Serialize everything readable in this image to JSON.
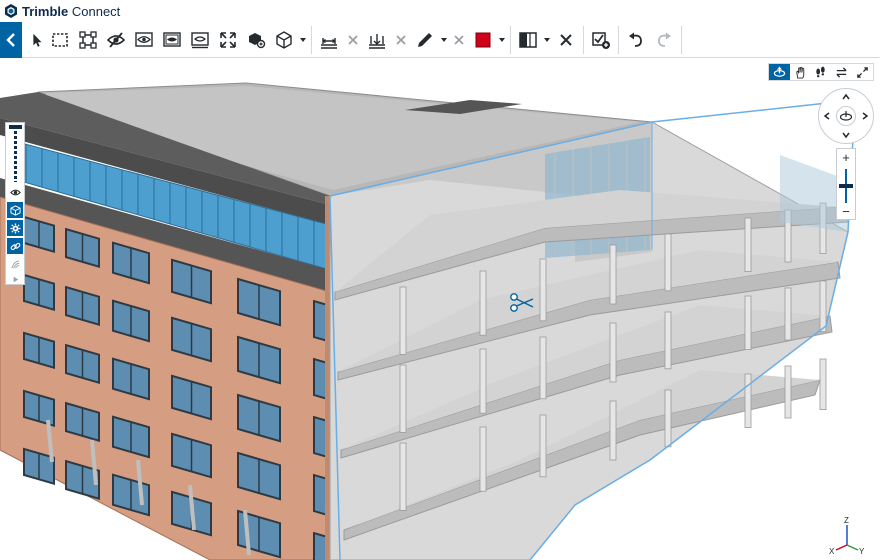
{
  "app": {
    "brand": "Trimble",
    "product": "Connect"
  },
  "colors": {
    "primary": "#0063a3",
    "dark": "#0d2b4a",
    "markup": "#d0021b",
    "brick": "#d59e82",
    "glass": "#4d9fcf",
    "section_edge": "#6aaee6"
  },
  "toolbar": {
    "groups": [
      [
        "select-icon",
        "box-select-icon",
        "fit-select-icon",
        "hide-icon",
        "isolate-icon",
        "show-all-icon",
        "hidden-list-icon",
        "fit-view-icon",
        "object-tree-icon",
        "view-cube-icon"
      ],
      [
        "measure-icon",
        "clear-measure-icon",
        "section-plane-icon",
        "clear-section-icon",
        "pen-icon",
        "clear-pen-icon",
        "color-picker-icon"
      ],
      [
        "compare-icon",
        "close-icon",
        "create-view-icon"
      ],
      [
        "undo-icon",
        "redo-icon"
      ]
    ]
  },
  "left_panel": {
    "items": [
      "visibility-icon",
      "object-icon",
      "settings-icon",
      "link-icon",
      "sun-icon",
      "play-icon"
    ]
  },
  "navigation": {
    "modes": [
      "orbit-icon",
      "pan-icon",
      "walk-icon",
      "switch-icon",
      "fullscreen-icon"
    ],
    "active_mode": "orbit-icon"
  },
  "axes": {
    "x": "X",
    "y": "Y",
    "z": "Z"
  }
}
